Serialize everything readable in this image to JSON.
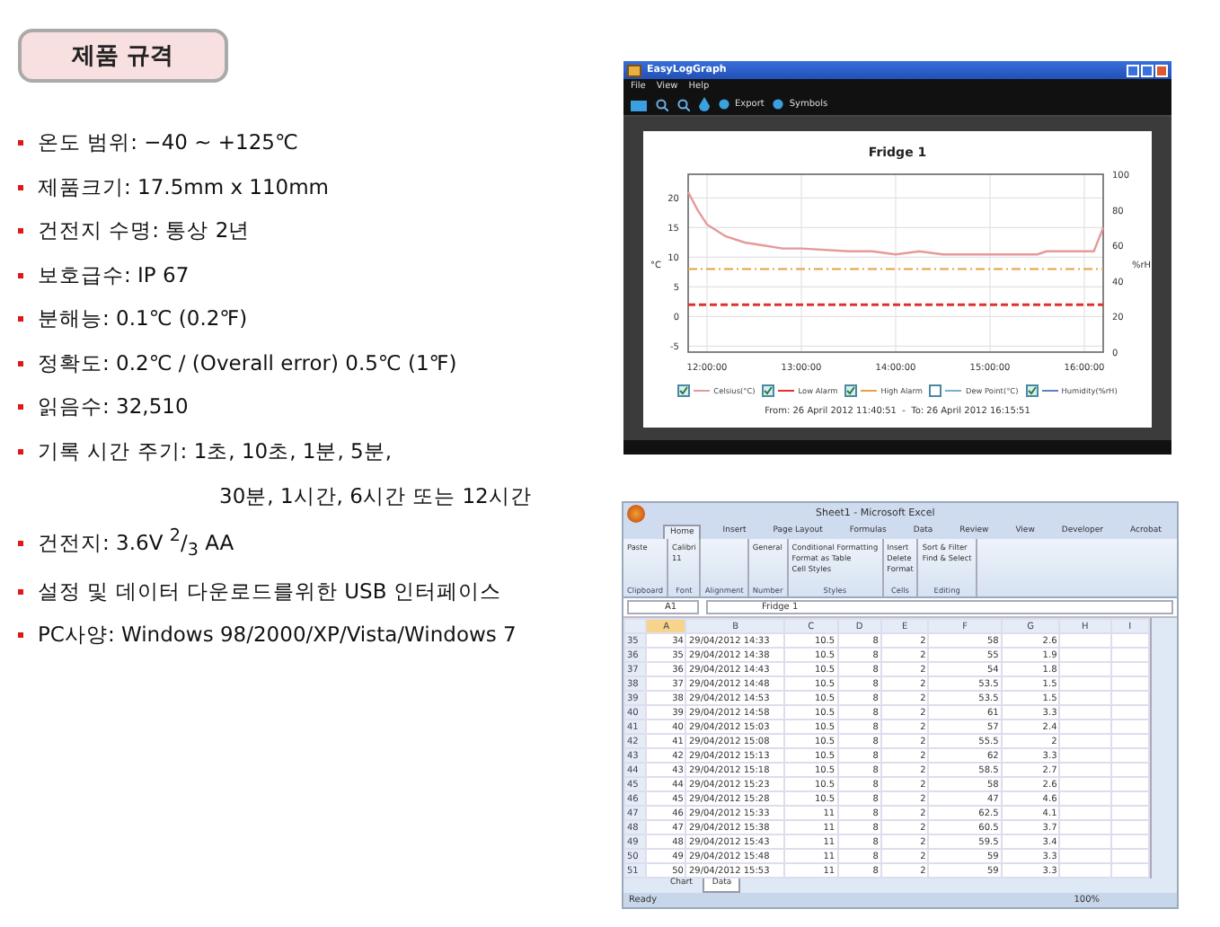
{
  "heading": "제품 규격",
  "specs": [
    {
      "text": "온도 범위: −40 ~ +125℃"
    },
    {
      "text": "제품크기: 17.5mm x 110mm"
    },
    {
      "text": "건전지 수명: 통상 2년"
    },
    {
      "text": "보호급수: IP 67"
    },
    {
      "text": "분해능: 0.1℃ (0.2℉)"
    },
    {
      "text": "정확도: 0.2℃ / (Overall error) 0.5℃ (1℉)"
    },
    {
      "text": "읽음수: 32,510"
    },
    {
      "text": "기록 시간 주기: 1초, 10초, 1분, 5분,",
      "continuation": "30분, 1시간, 6시간 또는 12시간"
    },
    {
      "text": "건전지: 3.6V $^{2}$/$_{3}$ AA"
    },
    {
      "text": "설정 및 데이터 다운로드를위한 USB 인터페이스"
    },
    {
      "text": "PC사양: Windows 98/2000/XP/Vista/Windows 7"
    }
  ],
  "chart_window": {
    "title": "EasyLogGraph",
    "menu": [
      "File",
      "View",
      "Help"
    ],
    "toolbar": [
      "Export",
      "Symbols"
    ],
    "chart_data": {
      "type": "line",
      "title": "Fridge 1",
      "ylabel": "°C",
      "x": [
        11.8,
        11.9,
        12,
        12.2,
        12.4,
        12.6,
        12.8,
        13,
        13.5,
        13.75,
        14,
        14.25,
        14.5,
        15,
        15.5,
        15.6,
        16,
        16.1,
        16.2
      ],
      "series": [
        {
          "name": "Celsius(°C)",
          "color": "#e49a9a",
          "line_style": "solid",
          "values": [
            21,
            18,
            15.5,
            13.5,
            12.5,
            12,
            11.5,
            11.5,
            11,
            11,
            10.5,
            11,
            10.5,
            10.5,
            10.5,
            11,
            11,
            11,
            15
          ]
        },
        {
          "name": "Low Alarm",
          "color": "#e03030",
          "line_style": "dashed",
          "values": [
            2,
            2,
            2,
            2,
            2,
            2,
            2,
            2,
            2,
            2,
            2,
            2,
            2,
            2,
            2,
            2,
            2,
            2,
            2
          ]
        },
        {
          "name": "High Alarm",
          "color": "#e8a040",
          "line_style": "dashdot",
          "values": [
            8,
            8,
            8,
            8,
            8,
            8,
            8,
            8,
            8,
            8,
            8,
            8,
            8,
            8,
            8,
            8,
            8,
            8,
            8
          ]
        }
      ],
      "xlim": [
        11.8,
        16.2
      ],
      "ylim": [
        -6,
        24
      ],
      "grid": true,
      "legend": "bottom",
      "xticks": [
        {
          "value": 12,
          "label": "12:00:00"
        },
        {
          "value": 13,
          "label": "13:00:00"
        },
        {
          "value": 14,
          "label": "14:00:00"
        },
        {
          "value": 15,
          "label": "15:00:00"
        },
        {
          "value": 16,
          "label": "16:00:00"
        }
      ],
      "yticks": [
        -5,
        0,
        5,
        10,
        15,
        20
      ]
    },
    "right_axis": {
      "label": "%rH",
      "ticks": [
        "100",
        "80",
        "60",
        "40",
        "20",
        "0"
      ]
    },
    "series_checked": [
      true,
      true,
      true
    ],
    "extra_legend": [
      {
        "label": "Dew Point(°C)",
        "checked": false,
        "color": "#7ab0c8"
      },
      {
        "label": "Humidity(%rH)",
        "checked": true,
        "color": "#6080c0"
      }
    ],
    "footer": "From: 26 April 2012 11:40:51  -  To: 26 April 2012 16:15:51"
  },
  "excel": {
    "title": "Sheet1 - Microsoft Excel",
    "tabs": [
      {
        "label": "Home",
        "selected": true
      },
      {
        "label": "Insert",
        "selected": false
      },
      {
        "label": "Page Layout",
        "selected": false
      },
      {
        "label": "Formulas",
        "selected": false
      },
      {
        "label": "Data",
        "selected": false
      },
      {
        "label": "Review",
        "selected": false
      },
      {
        "label": "View",
        "selected": false
      },
      {
        "label": "Developer",
        "selected": false
      },
      {
        "label": "Acrobat",
        "selected": false
      }
    ],
    "ribbon": [
      {
        "group": "Clipboard",
        "buttons": [
          "Paste"
        ]
      },
      {
        "group": "Font",
        "buttons": [
          "Calibri",
          "11"
        ]
      },
      {
        "group": "Alignment"
      },
      {
        "group": "Number",
        "buttons": [
          "General"
        ]
      },
      {
        "group": "Styles",
        "buttons": [
          "Conditional Formatting",
          "Format as Table",
          "Cell Styles"
        ]
      },
      {
        "group": "Cells",
        "buttons": [
          "Insert",
          "Delete",
          "Format"
        ]
      },
      {
        "group": "Editing",
        "buttons": [
          "Sort & Filter",
          "Find & Select"
        ]
      }
    ],
    "name_box": "A1",
    "formula": "Fridge 1",
    "columns": [
      "A",
      "B",
      "C",
      "D",
      "E",
      "F",
      "G",
      "H",
      "I"
    ],
    "rows": [
      {
        "num": "35",
        "cells": [
          "34",
          "29/04/2012 14:33",
          "10.5",
          "8",
          "2",
          "58",
          "2.6"
        ]
      },
      {
        "num": "36",
        "cells": [
          "35",
          "29/04/2012 14:38",
          "10.5",
          "8",
          "2",
          "55",
          "1.9"
        ]
      },
      {
        "num": "37",
        "cells": [
          "36",
          "29/04/2012 14:43",
          "10.5",
          "8",
          "2",
          "54",
          "1.8"
        ]
      },
      {
        "num": "38",
        "cells": [
          "37",
          "29/04/2012 14:48",
          "10.5",
          "8",
          "2",
          "53.5",
          "1.5"
        ]
      },
      {
        "num": "39",
        "cells": [
          "38",
          "29/04/2012 14:53",
          "10.5",
          "8",
          "2",
          "53.5",
          "1.5"
        ]
      },
      {
        "num": "40",
        "cells": [
          "39",
          "29/04/2012 14:58",
          "10.5",
          "8",
          "2",
          "61",
          "3.3"
        ]
      },
      {
        "num": "41",
        "cells": [
          "40",
          "29/04/2012 15:03",
          "10.5",
          "8",
          "2",
          "57",
          "2.4"
        ]
      },
      {
        "num": "42",
        "cells": [
          "41",
          "29/04/2012 15:08",
          "10.5",
          "8",
          "2",
          "55.5",
          "2"
        ]
      },
      {
        "num": "43",
        "cells": [
          "42",
          "29/04/2012 15:13",
          "10.5",
          "8",
          "2",
          "62",
          "3.3"
        ]
      },
      {
        "num": "44",
        "cells": [
          "43",
          "29/04/2012 15:18",
          "10.5",
          "8",
          "2",
          "58.5",
          "2.7"
        ]
      },
      {
        "num": "45",
        "cells": [
          "44",
          "29/04/2012 15:23",
          "10.5",
          "8",
          "2",
          "58",
          "2.6"
        ]
      },
      {
        "num": "46",
        "cells": [
          "45",
          "29/04/2012 15:28",
          "10.5",
          "8",
          "2",
          "47",
          "4.6"
        ]
      },
      {
        "num": "47",
        "cells": [
          "46",
          "29/04/2012 15:33",
          "11",
          "8",
          "2",
          "62.5",
          "4.1"
        ]
      },
      {
        "num": "48",
        "cells": [
          "47",
          "29/04/2012 15:38",
          "11",
          "8",
          "2",
          "60.5",
          "3.7"
        ]
      },
      {
        "num": "49",
        "cells": [
          "48",
          "29/04/2012 15:43",
          "11",
          "8",
          "2",
          "59.5",
          "3.4"
        ]
      },
      {
        "num": "50",
        "cells": [
          "49",
          "29/04/2012 15:48",
          "11",
          "8",
          "2",
          "59",
          "3.3"
        ]
      },
      {
        "num": "51",
        "cells": [
          "50",
          "29/04/2012 15:53",
          "11",
          "8",
          "2",
          "59",
          "3.3"
        ]
      }
    ],
    "sheet_tabs": [
      {
        "label": "Chart",
        "selected": false
      },
      {
        "label": "Data",
        "selected": true
      }
    ],
    "status": "Ready",
    "zoom": "100%"
  }
}
